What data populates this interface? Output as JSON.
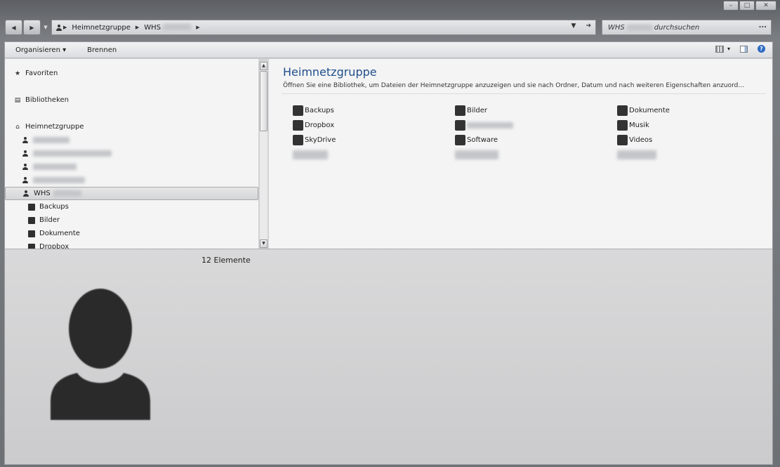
{
  "window": {
    "caption": {
      "minimize": "–",
      "maximize": "□",
      "close": "✕"
    }
  },
  "navbar": {
    "back_icon": "back-arrow-icon",
    "forward_icon": "forward-arrow-icon",
    "breadcrumbs": [
      "Heimnetzgruppe",
      "WHS"
    ],
    "search_prefix": "WHS",
    "search_suffix": "durchsuchen",
    "search_more": "..."
  },
  "toolbar": {
    "organize_label": "Organisieren",
    "organize_arrow": "▾",
    "burn_label": "Brennen",
    "views_arrow": "▾",
    "help_label": "?"
  },
  "navpane": {
    "favorites": "Favoriten",
    "libraries": "Bibliotheken",
    "homegroup": "Heimnetzgruppe",
    "selected_user": "WHS",
    "folders": [
      "Backups",
      "Bilder",
      "Dokumente",
      "Dropbox"
    ]
  },
  "content": {
    "title": "Heimnetzgruppe",
    "description": "Öffnen Sie eine Bibliothek, um Dateien der Heimnetzgruppe anzuzeigen und sie nach Ordner, Datum und nach weiteren Eigenschaften anzuord...",
    "items": [
      "Backups",
      "Bilder",
      "Dokumente",
      "Dropbox",
      "Musik",
      "SkyDrive",
      "Software",
      "Videos"
    ]
  },
  "details": {
    "count": "12 Elemente"
  },
  "colors": {
    "title_blue": "#1f4e8c",
    "pane_bg": "#f4f4f4",
    "details_bg": "#d0d0d1"
  }
}
